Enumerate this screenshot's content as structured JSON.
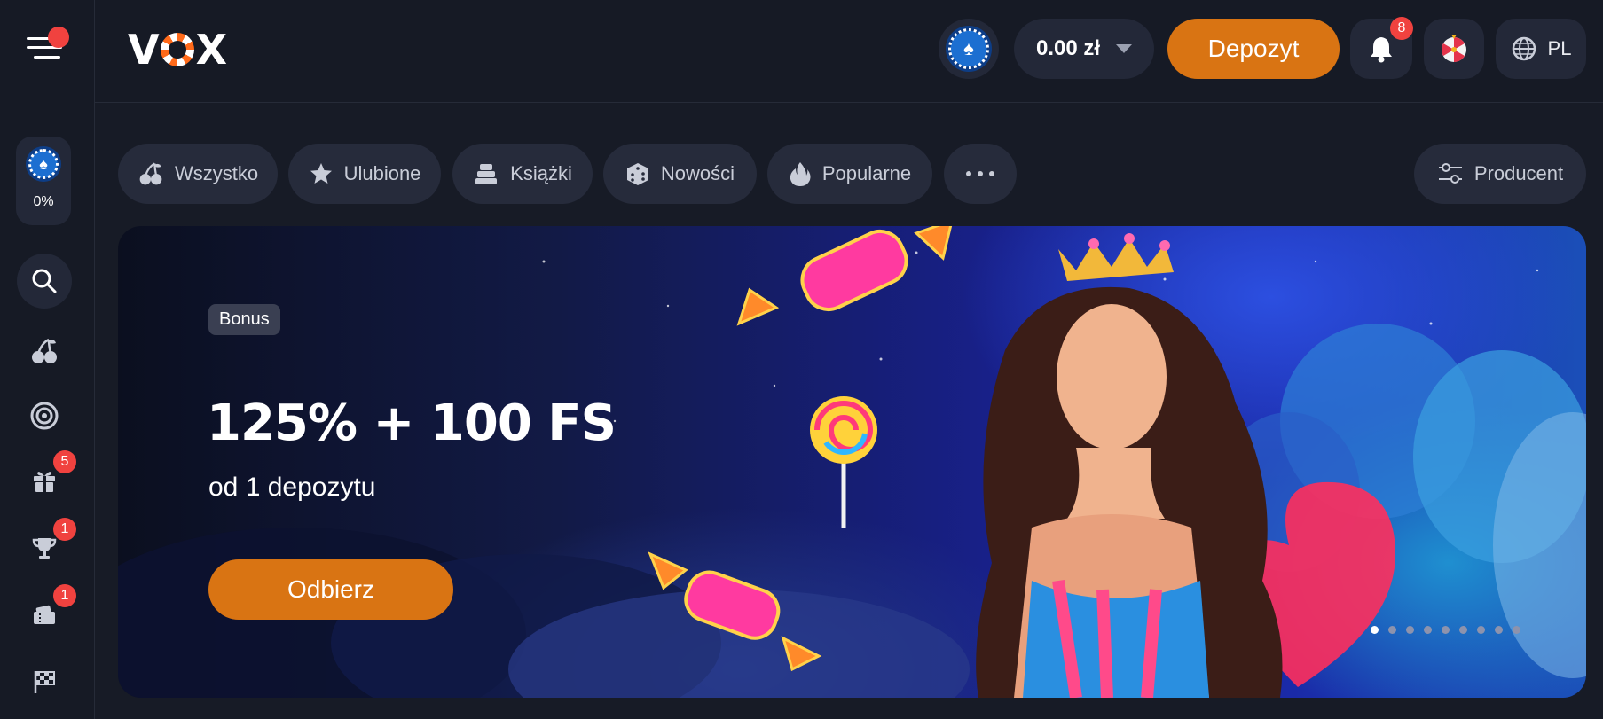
{
  "header": {
    "logo_text": "VOX",
    "balance": "0.00 zł",
    "deposit_label": "Depozyt",
    "notifications_count": "8",
    "language": "PL"
  },
  "sidebar": {
    "loyalty_percent": "0%",
    "items": [
      {
        "icon": "cherry-icon"
      },
      {
        "icon": "roulette-icon"
      },
      {
        "icon": "gift-icon",
        "badge": "5"
      },
      {
        "icon": "trophy-icon",
        "badge": "1"
      },
      {
        "icon": "tickets-icon",
        "badge": "1"
      },
      {
        "icon": "race-flag-icon"
      }
    ]
  },
  "categories": [
    {
      "label": "Wszystko",
      "icon": "cherry-icon"
    },
    {
      "label": "Ulubione",
      "icon": "star-icon"
    },
    {
      "label": "Książki",
      "icon": "books-icon"
    },
    {
      "label": "Nowości",
      "icon": "dice-icon"
    },
    {
      "label": "Popularne",
      "icon": "fire-icon"
    }
  ],
  "provider_filter_label": "Producent",
  "banner": {
    "tag": "Bonus",
    "headline": "125% + 100 FS",
    "subline": "od 1 depozytu",
    "cta": "Odbierz",
    "slide_count": 9,
    "active_slide": 1
  },
  "colors": {
    "accent": "#d97413",
    "badge": "#f0423f",
    "background": "#171b26",
    "surface": "#232838"
  }
}
